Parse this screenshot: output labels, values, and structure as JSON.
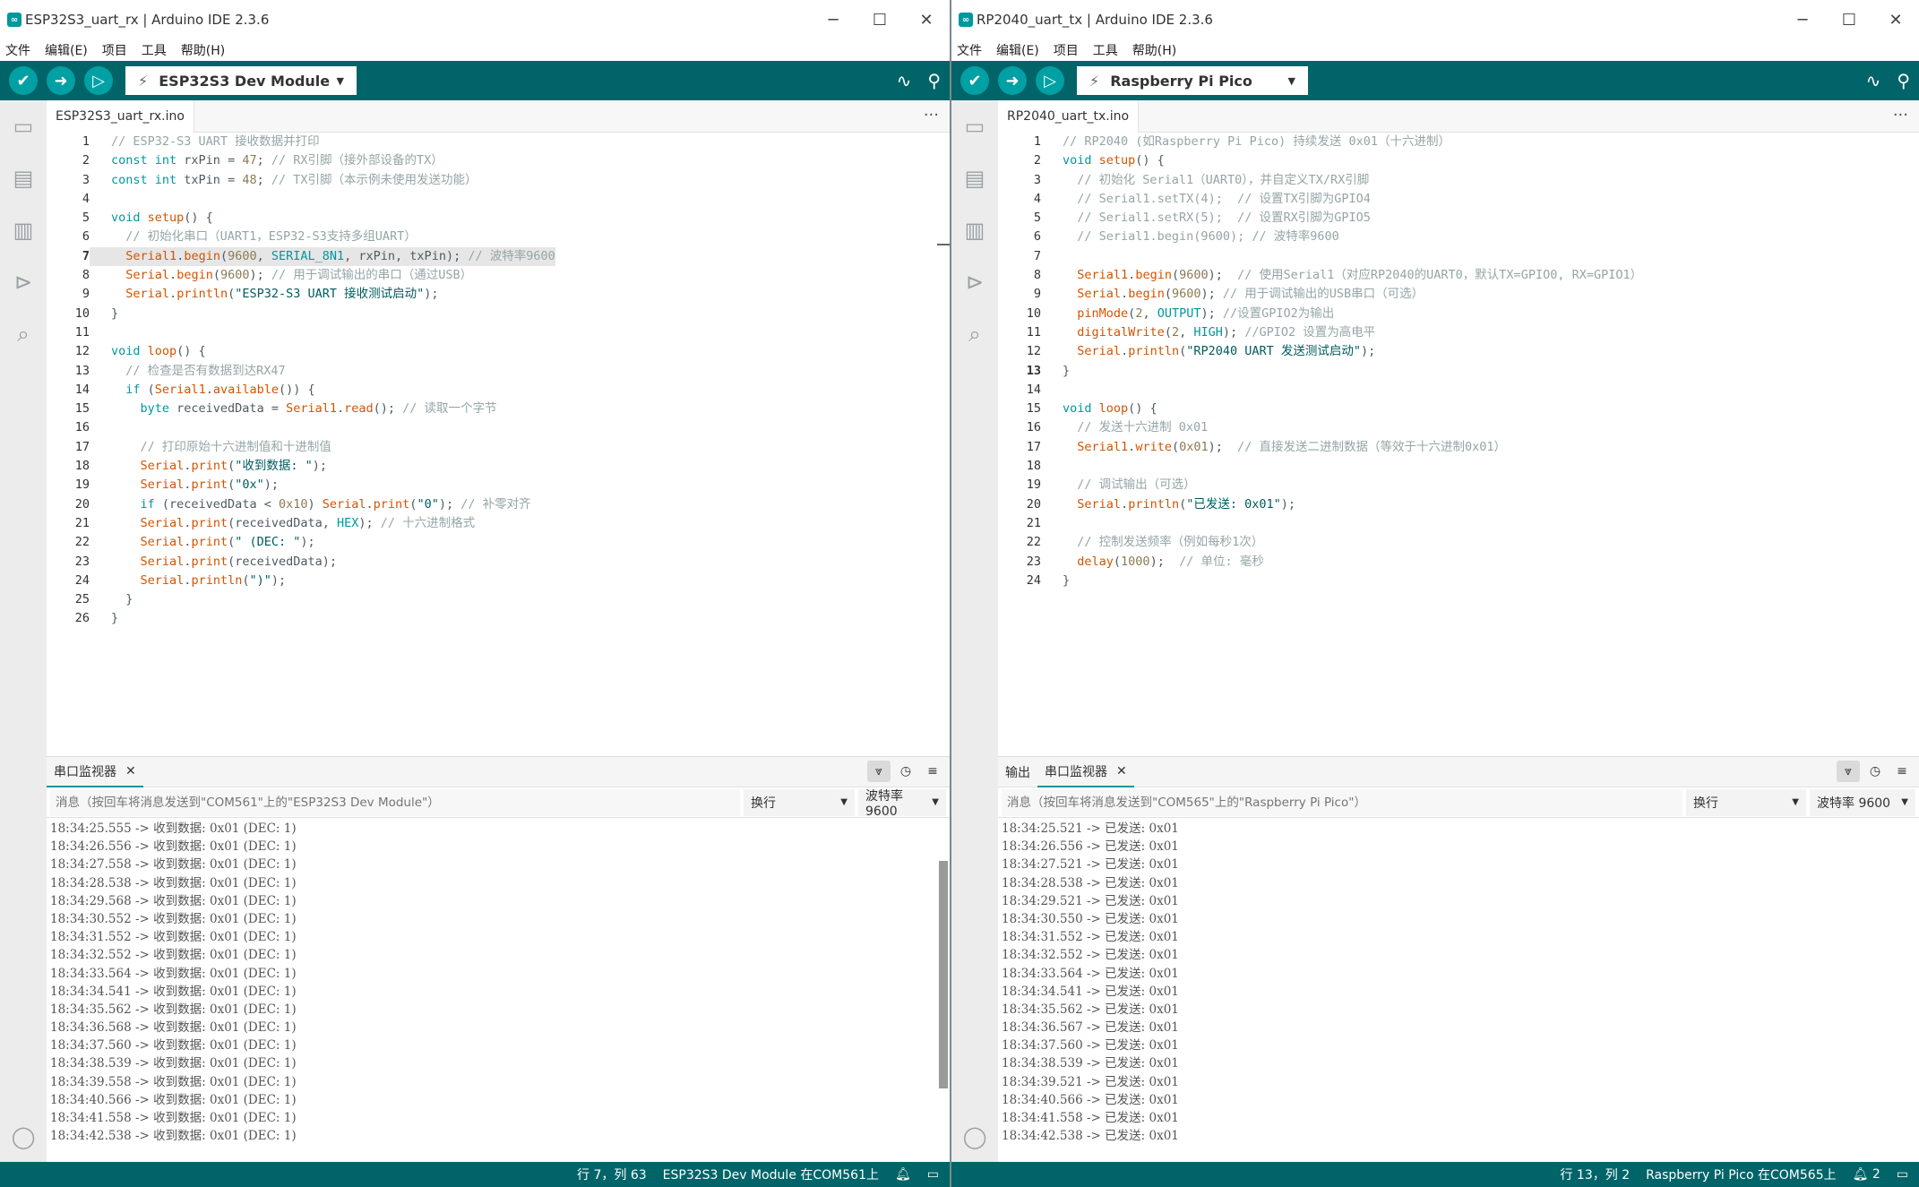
{
  "colors": {
    "toolbar": "#006468",
    "accent": "#00979d",
    "statusbar": "#006468"
  },
  "left": {
    "title": "ESP32S3_uart_rx | Arduino IDE 2.3.6",
    "menu": [
      "文件",
      "编辑(E)",
      "项目",
      "工具",
      "帮助(H)"
    ],
    "board": "ESP32S3 Dev Module",
    "file_tab": "ESP32S3_uart_rx.ino",
    "serial_tab": "串口监视器",
    "placeholder": "消息（按回车将消息发送到\"COM561\"上的\"ESP32S3 Dev Module\"）",
    "line_ending": "换行",
    "baud": "波特率 9600",
    "status_pos": "行 7，列 63",
    "status_board": "ESP32S3 Dev Module 在COM561上",
    "serial_lines": [
      "18:34:25.555 -> 收到数据: 0x01 (DEC: 1)",
      "18:34:26.556 -> 收到数据: 0x01 (DEC: 1)",
      "18:34:27.558 -> 收到数据: 0x01 (DEC: 1)",
      "18:34:28.538 -> 收到数据: 0x01 (DEC: 1)",
      "18:34:29.568 -> 收到数据: 0x01 (DEC: 1)",
      "18:34:30.552 -> 收到数据: 0x01 (DEC: 1)",
      "18:34:31.552 -> 收到数据: 0x01 (DEC: 1)",
      "18:34:32.552 -> 收到数据: 0x01 (DEC: 1)",
      "18:34:33.564 -> 收到数据: 0x01 (DEC: 1)",
      "18:34:34.541 -> 收到数据: 0x01 (DEC: 1)",
      "18:34:35.562 -> 收到数据: 0x01 (DEC: 1)",
      "18:34:36.568 -> 收到数据: 0x01 (DEC: 1)",
      "18:34:37.560 -> 收到数据: 0x01 (DEC: 1)",
      "18:34:38.539 -> 收到数据: 0x01 (DEC: 1)",
      "18:34:39.558 -> 收到数据: 0x01 (DEC: 1)",
      "18:34:40.566 -> 收到数据: 0x01 (DEC: 1)",
      "18:34:41.558 -> 收到数据: 0x01 (DEC: 1)",
      "18:34:42.538 -> 收到数据: 0x01 (DEC: 1)"
    ],
    "code": [
      {
        "n": "1",
        "t": "// ESP32-S3 UART 接收数据并打印"
      },
      {
        "n": "2",
        "t": "const int rxPin = 47; // RX引脚（接外部设备的TX）"
      },
      {
        "n": "3",
        "t": "const int txPin = 48; // TX引脚（本示例未使用发送功能）"
      },
      {
        "n": "4",
        "t": ""
      },
      {
        "n": "5",
        "t": "void setup() {"
      },
      {
        "n": "6",
        "t": "  // 初始化串口（UART1，ESP32-S3支持多组UART）"
      },
      {
        "n": "7",
        "t": "  Serial1.begin(9600, SERIAL_8N1, rxPin, txPin); // 波特率9600"
      },
      {
        "n": "8",
        "t": "  Serial.begin(9600); // 用于调试输出的串口（通过USB）"
      },
      {
        "n": "9",
        "t": "  Serial.println(\"ESP32-S3 UART 接收测试启动\");"
      },
      {
        "n": "10",
        "t": "}"
      },
      {
        "n": "11",
        "t": ""
      },
      {
        "n": "12",
        "t": "void loop() {"
      },
      {
        "n": "13",
        "t": "  // 检查是否有数据到达RX47"
      },
      {
        "n": "14",
        "t": "  if (Serial1.available()) {"
      },
      {
        "n": "15",
        "t": "    byte receivedData = Serial1.read(); // 读取一个字节"
      },
      {
        "n": "16",
        "t": ""
      },
      {
        "n": "17",
        "t": "    // 打印原始十六进制值和十进制值"
      },
      {
        "n": "18",
        "t": "    Serial.print(\"收到数据: \");"
      },
      {
        "n": "19",
        "t": "    Serial.print(\"0x\");"
      },
      {
        "n": "20",
        "t": "    if (receivedData < 0x10) Serial.print(\"0\"); // 补零对齐"
      },
      {
        "n": "21",
        "t": "    Serial.print(receivedData, HEX); // 十六进制格式"
      },
      {
        "n": "22",
        "t": "    Serial.print(\" (DEC: \");"
      },
      {
        "n": "23",
        "t": "    Serial.print(receivedData);"
      },
      {
        "n": "24",
        "t": "    Serial.println(\")\");"
      },
      {
        "n": "25",
        "t": "  }"
      },
      {
        "n": "26",
        "t": "}"
      }
    ]
  },
  "right": {
    "title": "RP2040_uart_tx | Arduino IDE 2.3.6",
    "menu": [
      "文件",
      "编辑(E)",
      "项目",
      "工具",
      "帮助(H)"
    ],
    "board": "Raspberry Pi Pico",
    "file_tab": "RP2040_uart_tx.ino",
    "output_tab": "输出",
    "serial_tab": "串口监视器",
    "placeholder": "消息（按回车将消息发送到\"COM565\"上的\"Raspberry Pi Pico\"）",
    "line_ending": "换行",
    "baud": "波特率 9600",
    "status_pos": "行 13，列 2",
    "status_board": "Raspberry Pi Pico 在COM565上",
    "notifications": "2",
    "serial_lines": [
      "18:34:25.521 -> 已发送: 0x01",
      "18:34:26.556 -> 已发送: 0x01",
      "18:34:27.521 -> 已发送: 0x01",
      "18:34:28.538 -> 已发送: 0x01",
      "18:34:29.521 -> 已发送: 0x01",
      "18:34:30.550 -> 已发送: 0x01",
      "18:34:31.552 -> 已发送: 0x01",
      "18:34:32.552 -> 已发送: 0x01",
      "18:34:33.564 -> 已发送: 0x01",
      "18:34:34.541 -> 已发送: 0x01",
      "18:34:35.562 -> 已发送: 0x01",
      "18:34:36.567 -> 已发送: 0x01",
      "18:34:37.560 -> 已发送: 0x01",
      "18:34:38.539 -> 已发送: 0x01",
      "18:34:39.521 -> 已发送: 0x01",
      "18:34:40.566 -> 已发送: 0x01",
      "18:34:41.558 -> 已发送: 0x01",
      "18:34:42.538 -> 已发送: 0x01"
    ],
    "code": [
      {
        "n": "1",
        "t": "// RP2040 (如Raspberry Pi Pico) 持续发送 0x01（十六进制）"
      },
      {
        "n": "2",
        "t": "void setup() {"
      },
      {
        "n": "3",
        "t": "  // 初始化 Serial1（UART0），并自定义TX/RX引脚"
      },
      {
        "n": "4",
        "t": "  // Serial1.setTX(4);  // 设置TX引脚为GPIO4"
      },
      {
        "n": "5",
        "t": "  // Serial1.setRX(5);  // 设置RX引脚为GPIO5"
      },
      {
        "n": "6",
        "t": "  // Serial1.begin(9600); // 波特率9600"
      },
      {
        "n": "7",
        "t": ""
      },
      {
        "n": "8",
        "t": "  Serial1.begin(9600);  // 使用Serial1（对应RP2040的UART0，默认TX=GPIO0, RX=GPIO1）"
      },
      {
        "n": "9",
        "t": "  Serial.begin(9600); // 用于调试输出的USB串口（可选）"
      },
      {
        "n": "10",
        "t": "  pinMode(2, OUTPUT); //设置GPIO2为输出"
      },
      {
        "n": "11",
        "t": "  digitalWrite(2, HIGH); //GPIO2 设置为高电平"
      },
      {
        "n": "12",
        "t": "  Serial.println(\"RP2040 UART 发送测试启动\");"
      },
      {
        "n": "13",
        "t": "}"
      },
      {
        "n": "14",
        "t": ""
      },
      {
        "n": "15",
        "t": "void loop() {"
      },
      {
        "n": "16",
        "t": "  // 发送十六进制 0x01"
      },
      {
        "n": "17",
        "t": "  Serial1.write(0x01);  // 直接发送二进制数据（等效于十六进制0x01）"
      },
      {
        "n": "18",
        "t": ""
      },
      {
        "n": "19",
        "t": "  // 调试输出（可选）"
      },
      {
        "n": "20",
        "t": "  Serial.println(\"已发送: 0x01\");"
      },
      {
        "n": "21",
        "t": ""
      },
      {
        "n": "22",
        "t": "  // 控制发送频率（例如每秒1次）"
      },
      {
        "n": "23",
        "t": "  delay(1000);  // 单位: 毫秒"
      },
      {
        "n": "24",
        "t": "}"
      }
    ]
  },
  "icons": {
    "verify": "check-icon",
    "upload": "arrow-right-icon",
    "debug": "debug-icon",
    "plotter": "serial-plotter-icon",
    "monitor": "serial-monitor-icon"
  }
}
